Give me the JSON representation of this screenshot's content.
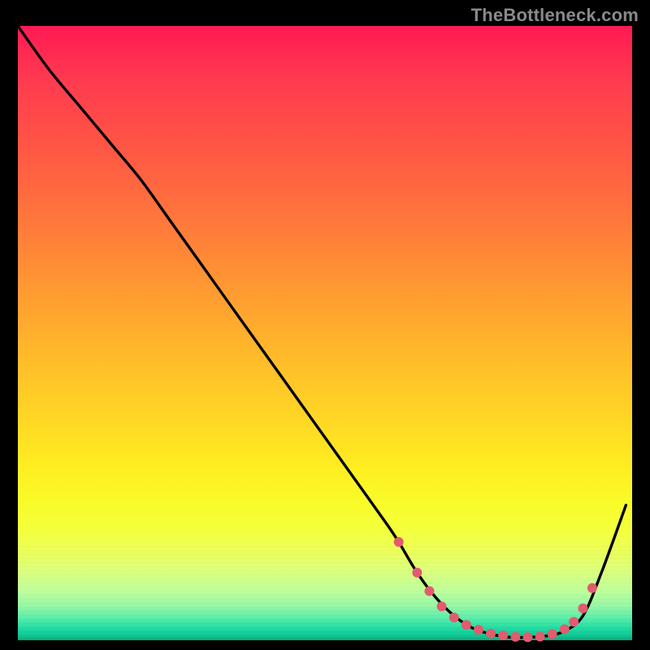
{
  "attribution": "TheBottleneck.com",
  "chart_data": {
    "type": "line",
    "title": "",
    "xlabel": "",
    "ylabel": "",
    "xlim": [
      0,
      100
    ],
    "ylim": [
      0,
      100
    ],
    "grid": false,
    "series": [
      {
        "name": "bottleneck-curve",
        "x": [
          0,
          5,
          10,
          15,
          20,
          25,
          30,
          35,
          40,
          45,
          50,
          55,
          60,
          62,
          65,
          68,
          71,
          74,
          77,
          80,
          83,
          86,
          89,
          92,
          95,
          99
        ],
        "values": [
          100,
          93,
          87,
          81,
          75,
          68,
          61,
          54,
          47,
          40,
          33,
          26,
          19,
          16,
          11,
          7,
          4,
          2,
          1,
          0.5,
          0.5,
          0.7,
          1.5,
          4,
          11,
          22
        ]
      }
    ],
    "markers": {
      "name": "highlight-dots",
      "color": "#e35b6e",
      "points": [
        {
          "x": 62,
          "y": 16
        },
        {
          "x": 65,
          "y": 11
        },
        {
          "x": 67,
          "y": 8
        },
        {
          "x": 69,
          "y": 5.5
        },
        {
          "x": 71,
          "y": 3.7
        },
        {
          "x": 73,
          "y": 2.5
        },
        {
          "x": 75,
          "y": 1.7
        },
        {
          "x": 77,
          "y": 1.1
        },
        {
          "x": 79,
          "y": 0.8
        },
        {
          "x": 81,
          "y": 0.55
        },
        {
          "x": 83,
          "y": 0.5
        },
        {
          "x": 85,
          "y": 0.6
        },
        {
          "x": 87,
          "y": 1.0
        },
        {
          "x": 89,
          "y": 1.8
        },
        {
          "x": 90.5,
          "y": 3.0
        },
        {
          "x": 92,
          "y": 5.2
        },
        {
          "x": 93.5,
          "y": 8.5
        }
      ]
    },
    "gradient_stops": [
      {
        "pos": 0.0,
        "color": "#ff1a54"
      },
      {
        "pos": 0.3,
        "color": "#ff7a3a"
      },
      {
        "pos": 0.6,
        "color": "#ffd326"
      },
      {
        "pos": 0.8,
        "color": "#f6ff34"
      },
      {
        "pos": 0.92,
        "color": "#bfff9c"
      },
      {
        "pos": 1.0,
        "color": "#0aa978"
      }
    ]
  }
}
